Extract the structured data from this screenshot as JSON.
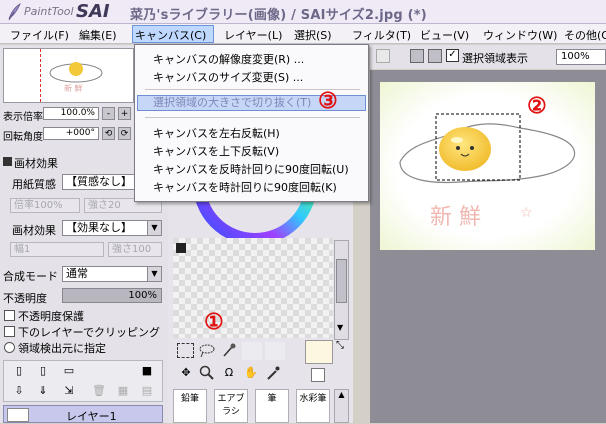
{
  "app": {
    "logo_small": "PaintTool",
    "logo_big": "SAI",
    "document_title": "菜乃'sライブラリー(画像) / SAIサイズ2.jpg (*)"
  },
  "menubar": [
    {
      "label": "ファイル(F)"
    },
    {
      "label": "編集(E)"
    },
    {
      "label": "キャンバス(C)"
    },
    {
      "label": "レイヤー(L)"
    },
    {
      "label": "選択(S)"
    },
    {
      "label": "フィルタ(T)"
    },
    {
      "label": "ビュー(V)"
    },
    {
      "label": "ウィンドウ(W)"
    },
    {
      "label": "その他(O"
    }
  ],
  "canvas_menu": {
    "items": [
      "キャンバスの解像度変更(R) ...",
      "キャンバスのサイズ変更(S) ...",
      "選択領域の大きさで切り抜く(T)",
      "キャンバスを左右反転(H)",
      "キャンバスを上下反転(V)",
      "キャンバスを反時計回りに90度回転(U)",
      "キャンバスを時計回りに90度回転(K)"
    ]
  },
  "canvas_toolbar": {
    "show_selection_label": "選択領域表示",
    "show_selection_checked": true,
    "zoom": "100%"
  },
  "navigator": {
    "zoom_label": "表示倍率",
    "zoom_value": "100.0%",
    "rotation_label": "回転角度",
    "rotation_value": "+000°"
  },
  "paper_effect": {
    "section_label": "画材効果",
    "texture_label": "用紙質感",
    "texture_value": "【質感なし】",
    "scale_label": "倍率",
    "scale_value": "100%",
    "strength_label": "強さ",
    "strength_value": "20",
    "effect_label": "画材効果",
    "effect_value": "【効果なし】",
    "width_label": "幅",
    "width_value": "1",
    "effect_strength_label": "強さ",
    "effect_strength_value": "100"
  },
  "layer_props": {
    "blend_label": "合成モード",
    "blend_value": "通常",
    "opacity_label": "不透明度",
    "opacity_value": "100%",
    "opacity_fraction": 1.0,
    "protect_label": "不透明度保護",
    "clip_label": "下のレイヤーでクリッピング",
    "source_label": "領域検出元に指定"
  },
  "layers": [
    {
      "name": "レイヤー1"
    }
  ],
  "brush_tabs": [
    "鉛筆",
    "エアブラシ",
    "筆",
    "水彩筆"
  ],
  "artwork": {
    "text": "新 鮮",
    "star": "☆"
  },
  "annotations": [
    "①",
    "②",
    "③"
  ],
  "colors": {
    "menu_highlight": "#bfd8ff",
    "annotation_red": "#e01212",
    "egg_yolk": "#f3c93a"
  },
  "icons": [
    "feather-icon",
    "selection-rect-icon",
    "lasso-icon",
    "magic-wand-icon",
    "move-icon",
    "zoom-icon",
    "rotate-icon",
    "hand-icon",
    "eyedropper-icon"
  ]
}
